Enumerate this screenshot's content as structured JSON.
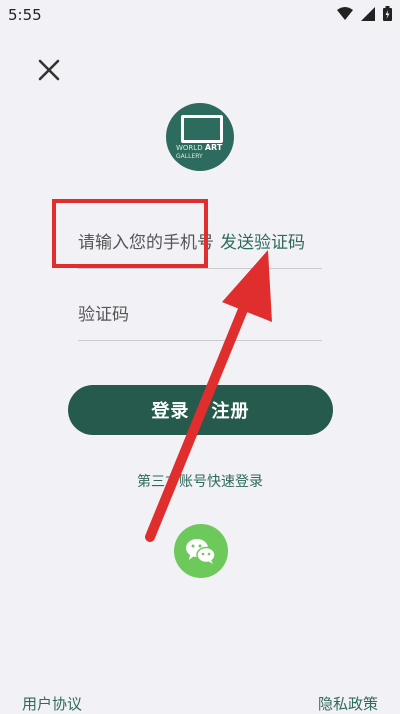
{
  "status_bar": {
    "time": "5:55"
  },
  "logo": {
    "line1_prefix": "WORLD",
    "line1_bold": "ART",
    "line2": "GALLERY"
  },
  "form": {
    "phone_placeholder": "请输入您的手机号",
    "send_code_label": "发送验证码",
    "code_placeholder": "验证码",
    "login_label": "登录 / 注册"
  },
  "third_party": {
    "label": "第三方账号快速登录"
  },
  "footer": {
    "user_agreement": "用户协议",
    "privacy_policy": "隐私政策"
  },
  "colors": {
    "accent": "#255a4c",
    "annotation": "#e02e2e",
    "wechat": "#6ec95c"
  },
  "icons": [
    "close-icon",
    "wifi-icon",
    "signal-icon",
    "battery-icon",
    "wechat-icon"
  ]
}
